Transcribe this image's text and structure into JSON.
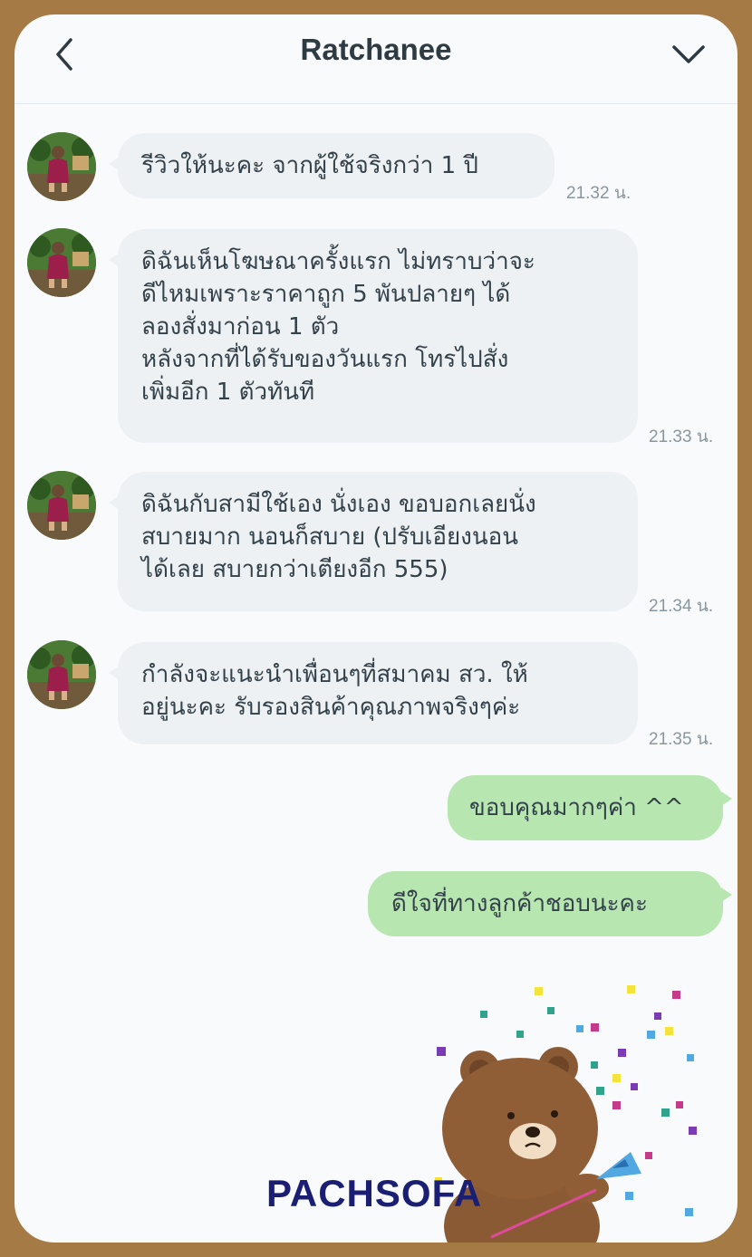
{
  "header": {
    "title": "Ratchanee",
    "back_icon": "chevron-left-icon",
    "menu_icon": "chevron-down-icon"
  },
  "messages": [
    {
      "from": "Ratchanee",
      "lines": [
        "รีวิวให้นะคะ จากผู้ใช้จริงกว่า 1 ปี"
      ],
      "time": "21.32 น."
    },
    {
      "from": "Ratchanee",
      "lines": [
        "ดิฉันเห็นโฆษณาครั้งแรก ไม่ทราบว่าจะ",
        "ดีไหมเพราะราคาถูก 5 พันปลายๆ ได้",
        "ลองสั่งมาก่อน 1 ตัว",
        "หลังจากที่ได้รับของวันแรก โทรไปสั่ง",
        "เพิ่มอีก 1 ตัวทันที"
      ],
      "time": "21.33 น."
    },
    {
      "from": "Ratchanee",
      "lines": [
        "ดิฉันกับสามีใช้เอง นั่งเอง ขอบอกเลยนั่ง",
        "สบายมาก นอนก็สบาย (ปรับเอียงนอน",
        "ได้เลย สบายกว่าเตียงอีก 555)"
      ],
      "time": "21.34 น."
    },
    {
      "from": "Ratchanee",
      "lines": [
        "กำลังจะแนะนำเพื่อนๆที่สมาคม สว. ให้",
        "อยู่นะคะ รับรองสินค้าคุณภาพจริงๆค่ะ"
      ],
      "time": "21.35 น."
    },
    {
      "from": "me",
      "lines": [
        "ขอบคุณมากๆค่า ^^"
      ]
    },
    {
      "from": "me",
      "lines": [
        "ดีใจที่ทางลูกค้าชอบนะคะ"
      ]
    }
  ],
  "sticker": {
    "icon": "bear-confetti-sticker"
  },
  "watermark": "PACHSOFA",
  "colors": {
    "frame": "#a67a45",
    "incoming_bubble": "#eef1f3",
    "outgoing_bubble": "#b8e6b0",
    "text": "#33414a"
  }
}
